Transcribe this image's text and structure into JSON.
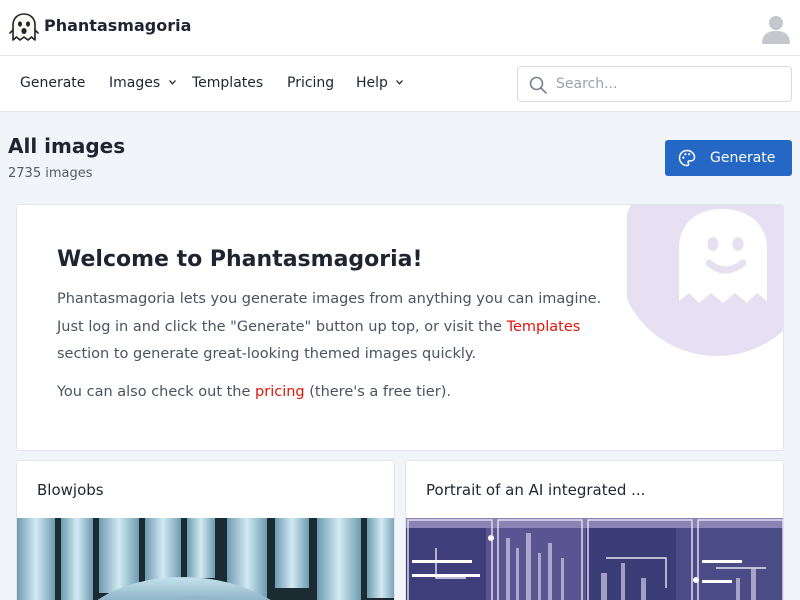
{
  "brand": {
    "name": "Phantasmagoria"
  },
  "nav": {
    "items": [
      {
        "label": "Generate",
        "has_dropdown": false
      },
      {
        "label": "Images",
        "has_dropdown": true
      },
      {
        "label": "Templates",
        "has_dropdown": false
      },
      {
        "label": "Pricing",
        "has_dropdown": false
      },
      {
        "label": "Help",
        "has_dropdown": true
      }
    ]
  },
  "search": {
    "placeholder": "Search...",
    "value": ""
  },
  "header": {
    "title": "All images",
    "count": "2735 images",
    "generate_button": "Generate"
  },
  "welcome": {
    "title": "Welcome to Phantasmagoria!",
    "para1_before": "Phantasmagoria lets you generate images from anything you can imagine. Just log in and click the \"Generate\" button up top, or visit the ",
    "para1_link": "Templates",
    "para1_after": " section to generate great-looking themed images quickly.",
    "para2_before": "You can also check out the ",
    "para2_link": "pricing",
    "para2_after": " (there's a free tier)."
  },
  "cards": [
    {
      "title": "Blowjobs"
    },
    {
      "title": "Portrait of an AI integrated ..."
    }
  ],
  "colors": {
    "accent": "#2467c4",
    "link": "#e0140c",
    "ghost_bg": "#e7e0f3"
  },
  "icons": {
    "logo": "ghost-logo-icon",
    "avatar": "user-avatar-icon",
    "search": "search-icon",
    "generate": "palette-icon",
    "dropdown": "chevron-down-icon"
  }
}
